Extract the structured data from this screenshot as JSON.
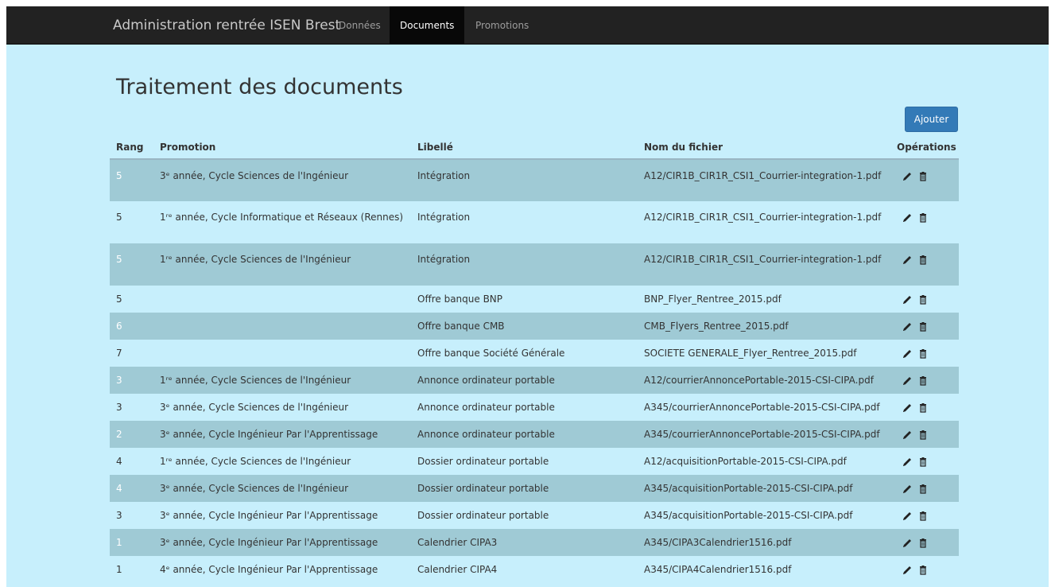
{
  "navbar": {
    "brand": "Administration rentrée ISEN Brest",
    "items": [
      {
        "label": "Données",
        "active": false
      },
      {
        "label": "Documents",
        "active": true
      },
      {
        "label": "Promotions",
        "active": false
      }
    ]
  },
  "page": {
    "title": "Traitement des documents",
    "add_button": "Ajouter"
  },
  "table": {
    "headers": [
      "Rang",
      "Promotion",
      "Libellé",
      "Nom du fichier",
      "Opérations"
    ],
    "rows": [
      {
        "rang": "5",
        "promotion": "3ᵉ année, Cycle Sciences de l'Ingénieur",
        "libelle": "Intégration",
        "fichier": "A12/CIR1B_CIR1R_CSI1_Courrier-integration-1.pdf"
      },
      {
        "rang": "5",
        "promotion": "1ʳᵉ année, Cycle Informatique et Réseaux (Rennes)",
        "libelle": "Intégration",
        "fichier": "A12/CIR1B_CIR1R_CSI1_Courrier-integration-1.pdf"
      },
      {
        "rang": "5",
        "promotion": "1ʳᵉ année, Cycle Sciences de l'Ingénieur",
        "libelle": "Intégration",
        "fichier": "A12/CIR1B_CIR1R_CSI1_Courrier-integration-1.pdf"
      },
      {
        "rang": "5",
        "promotion": "",
        "libelle": "Offre banque BNP",
        "fichier": "BNP_Flyer_Rentree_2015.pdf"
      },
      {
        "rang": "6",
        "promotion": "",
        "libelle": "Offre banque CMB",
        "fichier": "CMB_Flyers_Rentree_2015.pdf"
      },
      {
        "rang": "7",
        "promotion": "",
        "libelle": "Offre banque Société Générale",
        "fichier": "SOCIETE GENERALE_Flyer_Rentree_2015.pdf"
      },
      {
        "rang": "3",
        "promotion": "1ʳᵉ année, Cycle Sciences de l'Ingénieur",
        "libelle": "Annonce ordinateur portable",
        "fichier": "A12/courrierAnnoncePortable-2015-CSI-CIPA.pdf"
      },
      {
        "rang": "3",
        "promotion": "3ᵉ année, Cycle Sciences de l'Ingénieur",
        "libelle": "Annonce ordinateur portable",
        "fichier": "A345/courrierAnnoncePortable-2015-CSI-CIPA.pdf"
      },
      {
        "rang": "2",
        "promotion": "3ᵉ année, Cycle Ingénieur Par l'Apprentissage",
        "libelle": "Annonce ordinateur portable",
        "fichier": "A345/courrierAnnoncePortable-2015-CSI-CIPA.pdf"
      },
      {
        "rang": "4",
        "promotion": "1ʳᵉ année, Cycle Sciences de l'Ingénieur",
        "libelle": "Dossier ordinateur portable",
        "fichier": "A12/acquisitionPortable-2015-CSI-CIPA.pdf"
      },
      {
        "rang": "4",
        "promotion": "3ᵉ année, Cycle Sciences de l'Ingénieur",
        "libelle": "Dossier ordinateur portable",
        "fichier": "A345/acquisitionPortable-2015-CSI-CIPA.pdf"
      },
      {
        "rang": "3",
        "promotion": "3ᵉ année, Cycle Ingénieur Par l'Apprentissage",
        "libelle": "Dossier ordinateur portable",
        "fichier": "A345/acquisitionPortable-2015-CSI-CIPA.pdf"
      },
      {
        "rang": "1",
        "promotion": "3ᵉ année, Cycle Ingénieur Par l'Apprentissage",
        "libelle": "Calendrier CIPA3",
        "fichier": "A345/CIPA3Calendrier1516.pdf"
      },
      {
        "rang": "1",
        "promotion": "4ᵉ année, Cycle Ingénieur Par l'Apprentissage",
        "libelle": "Calendrier CIPA4",
        "fichier": "A345/CIPA4Calendrier1516.pdf"
      }
    ],
    "operation_icons": [
      "pencil-icon",
      "trash-icon"
    ]
  },
  "colors": {
    "background": "#c7effc",
    "stripe": "#9fcad5",
    "navbar": "#222222",
    "primary": "#337ab7"
  }
}
